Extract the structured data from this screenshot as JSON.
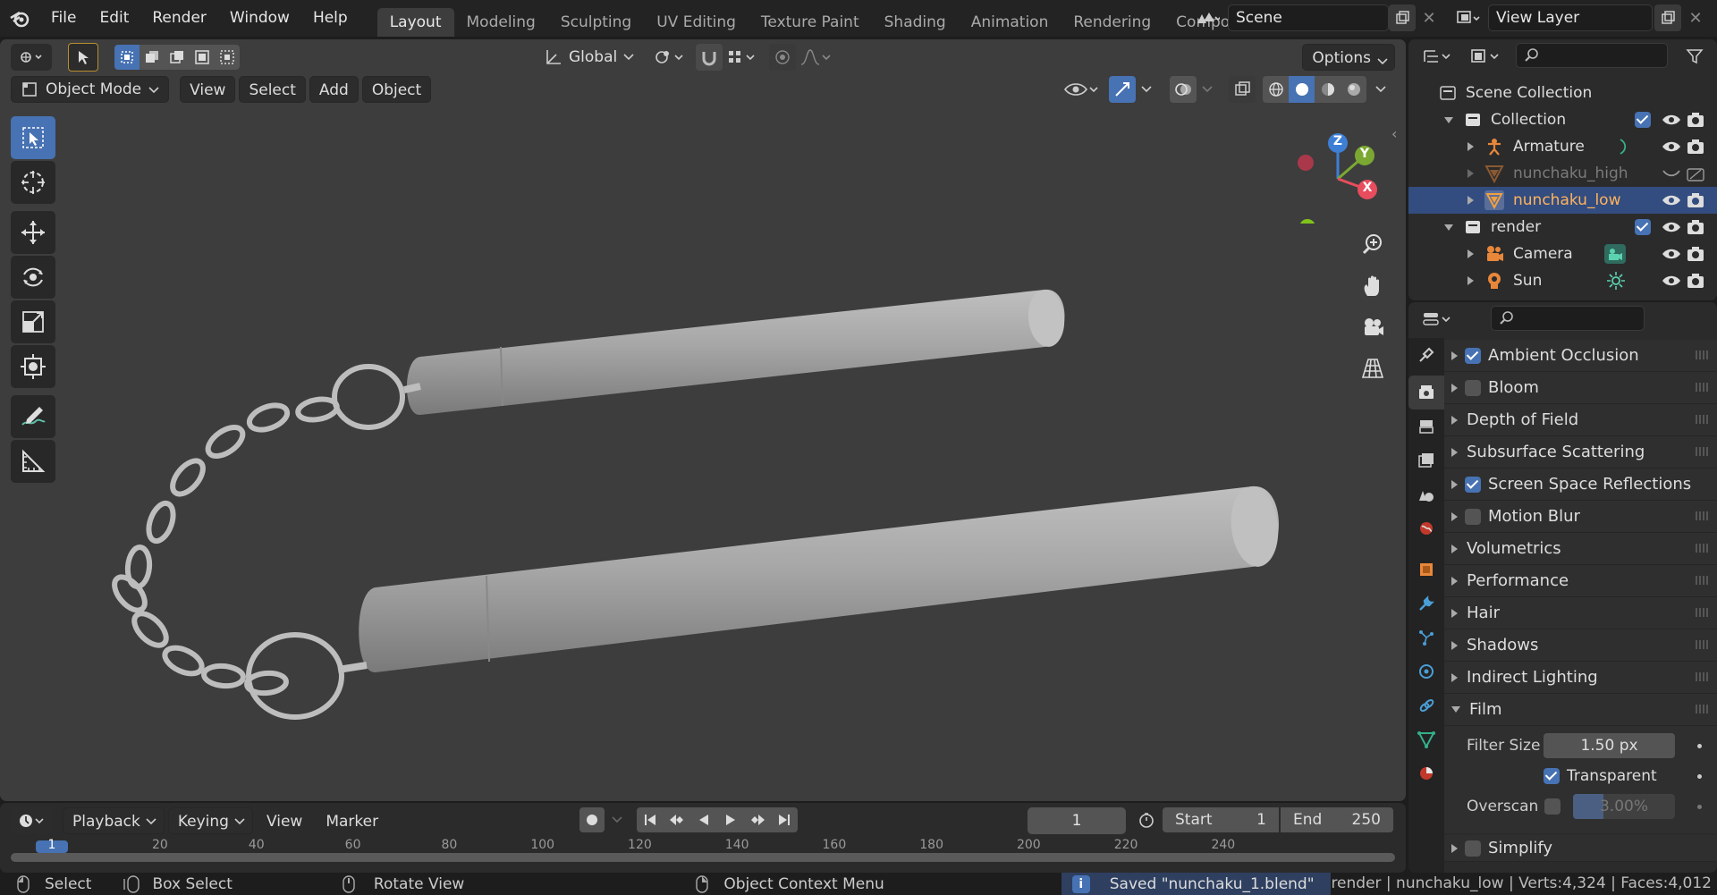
{
  "topbar": {
    "menus": [
      "File",
      "Edit",
      "Render",
      "Window",
      "Help"
    ],
    "workspaces": [
      "Layout",
      "Modeling",
      "Sculpting",
      "UV Editing",
      "Texture Paint",
      "Shading",
      "Animation",
      "Rendering",
      "Compos"
    ],
    "active_workspace": "Layout",
    "scene": "Scene",
    "view_layer": "View Layer"
  },
  "viewport": {
    "orientation": "Global",
    "options_label": "Options",
    "mode": "Object Mode",
    "menus": [
      "View",
      "Select",
      "Add",
      "Object"
    ],
    "gizmo_axes": {
      "x": "X",
      "y": "Y",
      "z": "Z"
    }
  },
  "timeline": {
    "menus": [
      "Playback",
      "Keying",
      "View",
      "Marker"
    ],
    "current_frame": "1",
    "start_label": "Start",
    "start": "1",
    "end_label": "End",
    "end": "250",
    "ruler_ticks": [
      "1",
      "20",
      "40",
      "60",
      "80",
      "100",
      "120",
      "140",
      "160",
      "180",
      "200",
      "220",
      "240"
    ]
  },
  "outliner": {
    "rows": [
      {
        "label": "Scene Collection",
        "icon": "scene-collection-icon"
      },
      {
        "label": "Collection",
        "icon": "collection-icon"
      },
      {
        "label": "Armature",
        "icon": "armature-icon"
      },
      {
        "label": "nunchaku_high",
        "icon": "mesh-icon"
      },
      {
        "label": "nunchaku_low",
        "icon": "mesh-icon",
        "selected": true
      },
      {
        "label": "render",
        "icon": "collection-icon"
      },
      {
        "label": "Camera",
        "icon": "camera-icon"
      },
      {
        "label": "Sun",
        "icon": "light-icon"
      }
    ]
  },
  "properties": {
    "sections": [
      {
        "label": "Ambient Occlusion",
        "checkbox": true
      },
      {
        "label": "Bloom",
        "checkbox": false
      },
      {
        "label": "Depth of Field"
      },
      {
        "label": "Subsurface Scattering"
      },
      {
        "label": "Screen Space Reflections",
        "checkbox": true
      },
      {
        "label": "Motion Blur",
        "checkbox": false
      },
      {
        "label": "Volumetrics"
      },
      {
        "label": "Performance"
      },
      {
        "label": "Hair"
      },
      {
        "label": "Shadows"
      },
      {
        "label": "Indirect Lighting"
      },
      {
        "label": "Film",
        "open": true
      }
    ],
    "film": {
      "filter_size_label": "Filter Size",
      "filter_size": "1.50 px",
      "transparent_label": "Transparent",
      "transparent": true,
      "overscan_label": "Overscan",
      "overscan": "3.00%",
      "simplify_label": "Simplify"
    }
  },
  "statusbar": {
    "select": "Select",
    "box_select": "Box Select",
    "rotate_view": "Rotate View",
    "context_menu": "Object Context Menu",
    "saved_message": "Saved \"nunchaku_1.blend\"",
    "stats": "render | nunchaku_low | Verts:4,324 | Faces:4,012"
  },
  "colors": {
    "accent": "#4772b3",
    "viewport_bg": "#3d3d3d",
    "panel_bg": "#2b2b2b",
    "x_axis": "#e84d5e",
    "y_axis": "#7ba832",
    "z_axis": "#3e7fd6"
  }
}
